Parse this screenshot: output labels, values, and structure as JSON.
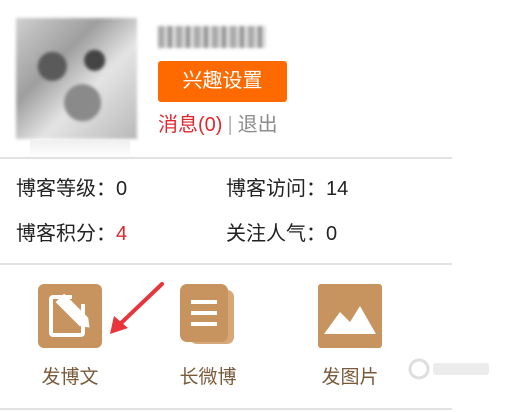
{
  "profile": {
    "interest_button": "兴趣设置",
    "messages_label": "消息(0)",
    "separator": "|",
    "logout_label": "退出"
  },
  "stats": {
    "level_label": "博客等级：",
    "level_value": "0",
    "visits_label": "博客访问：",
    "visits_value": "14",
    "points_label": "博客积分：",
    "points_value": "4",
    "followers_label": "关注人气：",
    "followers_value": "0"
  },
  "actions": [
    {
      "label": "发博文",
      "icon": "edit-icon"
    },
    {
      "label": "长微博",
      "icon": "document-icon"
    },
    {
      "label": "发图片",
      "icon": "image-icon"
    }
  ],
  "colors": {
    "accent": "#ff6a00",
    "highlight_red": "#e0282e",
    "icon_tan": "#c7935f",
    "annotation_red": "#e8353b"
  }
}
